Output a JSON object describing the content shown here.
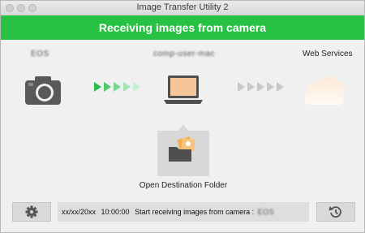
{
  "window": {
    "title": "Image Transfer Utility 2"
  },
  "banner": {
    "text": "Receiving images from camera"
  },
  "camera": {
    "name": "EOS"
  },
  "computer": {
    "name": "comp-user-mac"
  },
  "services": {
    "label": "Web Services"
  },
  "destination": {
    "label": "Open Destination Folder"
  },
  "status": {
    "date": "xx/xx/20xx",
    "time": "10:00:00",
    "message": "Start receiving images from camera :",
    "camera_name": "EOS"
  },
  "colors": {
    "accent": "#27c144"
  },
  "icons": {
    "camera": "camera-icon",
    "laptop": "laptop-icon",
    "cloud": "cloud-icon",
    "folder": "folder-icon",
    "settings": "gear-icon",
    "history": "history-icon"
  }
}
